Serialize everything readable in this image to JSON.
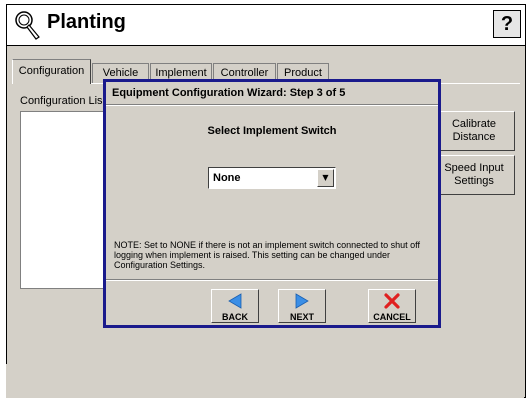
{
  "app": {
    "title": "Planting",
    "help_label": "?"
  },
  "tabs": [
    {
      "label": "Configuration",
      "active": true
    },
    {
      "label": "Vehicle"
    },
    {
      "label": "Implement"
    },
    {
      "label": "Controller"
    },
    {
      "label": "Product"
    }
  ],
  "configuration": {
    "list_label": "Configuration Lis",
    "buttons": [
      {
        "label": "Calibrate Distance"
      },
      {
        "label": "Speed Input Settings"
      }
    ]
  },
  "wizard": {
    "title": "Equipment Configuration Wizard:  Step 3 of 5",
    "heading": "Select Implement Switch",
    "dropdown_value": "None",
    "note": "NOTE:  Set to NONE if there is not an implement switch connected to shut off logging when implement is raised.  This setting can be changed under Configuration Settings.",
    "buttons": {
      "back": "BACK",
      "next": "NEXT",
      "cancel": "CANCEL"
    }
  },
  "icons": {
    "app": "wrench-magnifier-icon",
    "back": "left-arrow-icon",
    "next": "right-arrow-icon",
    "cancel": "red-x-icon",
    "dropdown": "chevron-down-icon"
  },
  "colors": {
    "wizard_border": "#1a1a8c",
    "arrow_blue": "#3a8ee6",
    "cancel_red": "#e02020",
    "window_bg": "#d4d0c8"
  }
}
